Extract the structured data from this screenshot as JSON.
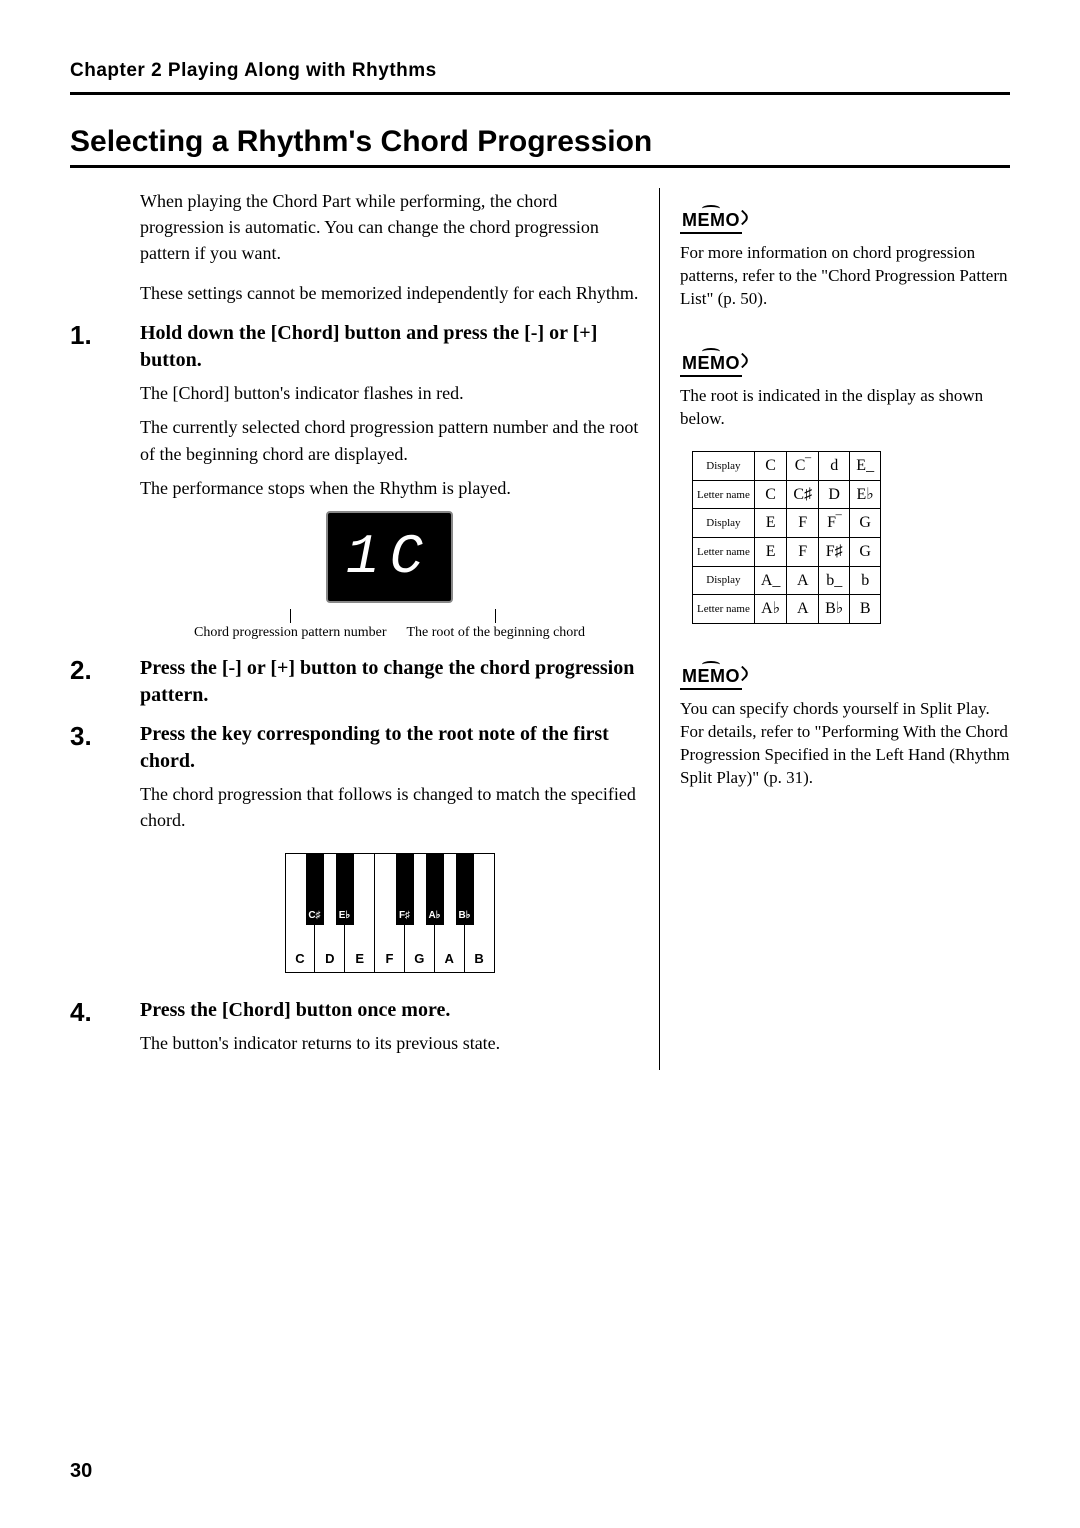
{
  "header": "Chapter 2 Playing Along with Rhythms",
  "title": "Selecting a Rhythm's Chord Progression",
  "intro1": "When playing the Chord Part while performing, the chord progression is automatic. You can change the chord progression pattern if you want.",
  "intro2": "These settings cannot be memorized independently for each Rhythm.",
  "steps": {
    "s1_num": "1.",
    "s1_head": "Hold down the [Chord] button and press the [-] or [+] button.",
    "s1_p1": "The [Chord] button's indicator flashes in red.",
    "s1_p2": "The currently selected chord progression pattern number and the root of the beginning chord are displayed.",
    "s1_p3": "The performance stops when the Rhythm is played.",
    "s2_num": "2.",
    "s2_head": "Press the [-] or [+] button to change the chord progression pattern.",
    "s3_num": "3.",
    "s3_head": "Press the key corresponding to the root note of the first chord.",
    "s3_p1": "The chord progression that follows is changed to match the specified chord.",
    "s4_num": "4.",
    "s4_head": "Press the [Chord] button once more.",
    "s4_p1": "The button's indicator returns to its previous state."
  },
  "display_text": "1C",
  "callout_left": "Chord progression pattern number",
  "callout_right": "The root of the beginning chord",
  "keyboard": {
    "white": [
      "C",
      "D",
      "E",
      "F",
      "G",
      "A",
      "B"
    ],
    "black": [
      "C♯",
      "E♭",
      "F♯",
      "A♭",
      "B♭"
    ]
  },
  "memo_label": "MEMO",
  "memo1": "For more information on chord progression patterns, refer to the \"Chord Progression Pattern List\" (p. 50).",
  "memo2": "The root is indicated in the display as shown below.",
  "memo3": "You can specify chords yourself in Split Play. For details, refer to \"Performing With the Chord Progression Specified in the Left Hand (Rhythm Split Play)\" (p. 31).",
  "chart_data": {
    "type": "table",
    "rows": [
      {
        "label": "Display",
        "cells": [
          "C",
          "C‾",
          "d",
          "E_"
        ]
      },
      {
        "label": "Letter name",
        "cells": [
          "C",
          "C♯",
          "D",
          "E♭"
        ]
      },
      {
        "label": "Display",
        "cells": [
          "E",
          "F",
          "F‾",
          "G"
        ]
      },
      {
        "label": "Letter name",
        "cells": [
          "E",
          "F",
          "F♯",
          "G"
        ]
      },
      {
        "label": "Display",
        "cells": [
          "A_",
          "A",
          "b_",
          "b"
        ]
      },
      {
        "label": "Letter name",
        "cells": [
          "A♭",
          "A",
          "B♭",
          "B"
        ]
      }
    ]
  },
  "page_number": "30"
}
